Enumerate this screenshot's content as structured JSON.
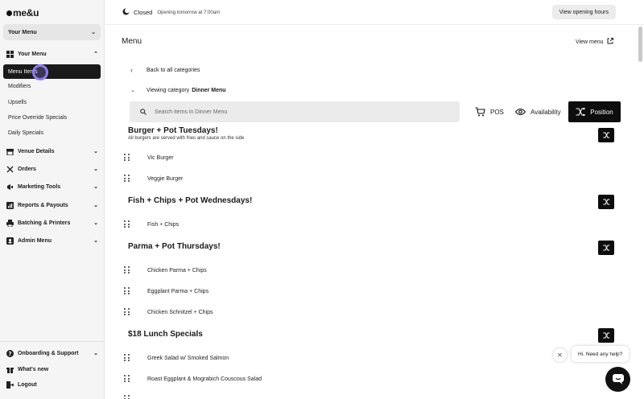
{
  "app": {
    "logo": "me&u"
  },
  "sidebar": {
    "venue_select": "Your Menu",
    "sections": [
      {
        "label": "Your Menu",
        "icon": "grid-icon",
        "expanded": true
      },
      {
        "label": "Venue Details",
        "icon": "store-icon"
      },
      {
        "label": "Orders",
        "icon": "utensils-icon"
      },
      {
        "label": "Marketing Tools",
        "icon": "megaphone-icon"
      },
      {
        "label": "Reports & Payouts",
        "icon": "chart-icon"
      },
      {
        "label": "Batching & Printers",
        "icon": "printer-icon"
      },
      {
        "label": "Admin Menu",
        "icon": "admin-icon"
      }
    ],
    "subitems": [
      "Menu Items",
      "Modifiers",
      "Upsells",
      "Price Override Specials",
      "Daily Specials"
    ],
    "active_subitem": "Menu Items",
    "footer": [
      {
        "label": "Onboarding & Support",
        "icon": "help-icon"
      },
      {
        "label": "What's new",
        "icon": "gift-icon"
      },
      {
        "label": "Logout",
        "icon": "logout-icon"
      }
    ]
  },
  "topbar": {
    "status": "Closed",
    "status_sub": "Opening tomorrow at 7:00am",
    "opening_button": "View opening hours"
  },
  "main": {
    "title": "Menu",
    "view_menu": "View menu",
    "back_link": "Back to all categories",
    "viewing_prefix": "Viewing category",
    "viewing_category": "Dinner Menu",
    "search_placeholder": "Search items in Dinner Menu",
    "tools": {
      "pos": "POS",
      "availability": "Availability",
      "position": "Position"
    },
    "categories": [
      {
        "title": "Burger + Pot Tuesdays!",
        "desc": "All burgers are served with fries and sauce on the side",
        "items": [
          "Vic Burger",
          "Veggie Burger"
        ]
      },
      {
        "title": "Fish + Chips + Pot Wednesdays!",
        "items": [
          "Fish + Chips"
        ]
      },
      {
        "title": "Parma + Pot Thursdays!",
        "items": [
          "Chicken Parma + Chips",
          "Eggplant Parma + Chips",
          "Chicken Schnitzel + Chips"
        ]
      },
      {
        "title": "$18 Lunch Specials",
        "items": [
          "Greek Salad w/ Smoked Salmon",
          "Roast Eggplant & Mograbich Couscous Salad"
        ]
      }
    ]
  },
  "chat": {
    "bubble": "Hi. Need any help?"
  }
}
